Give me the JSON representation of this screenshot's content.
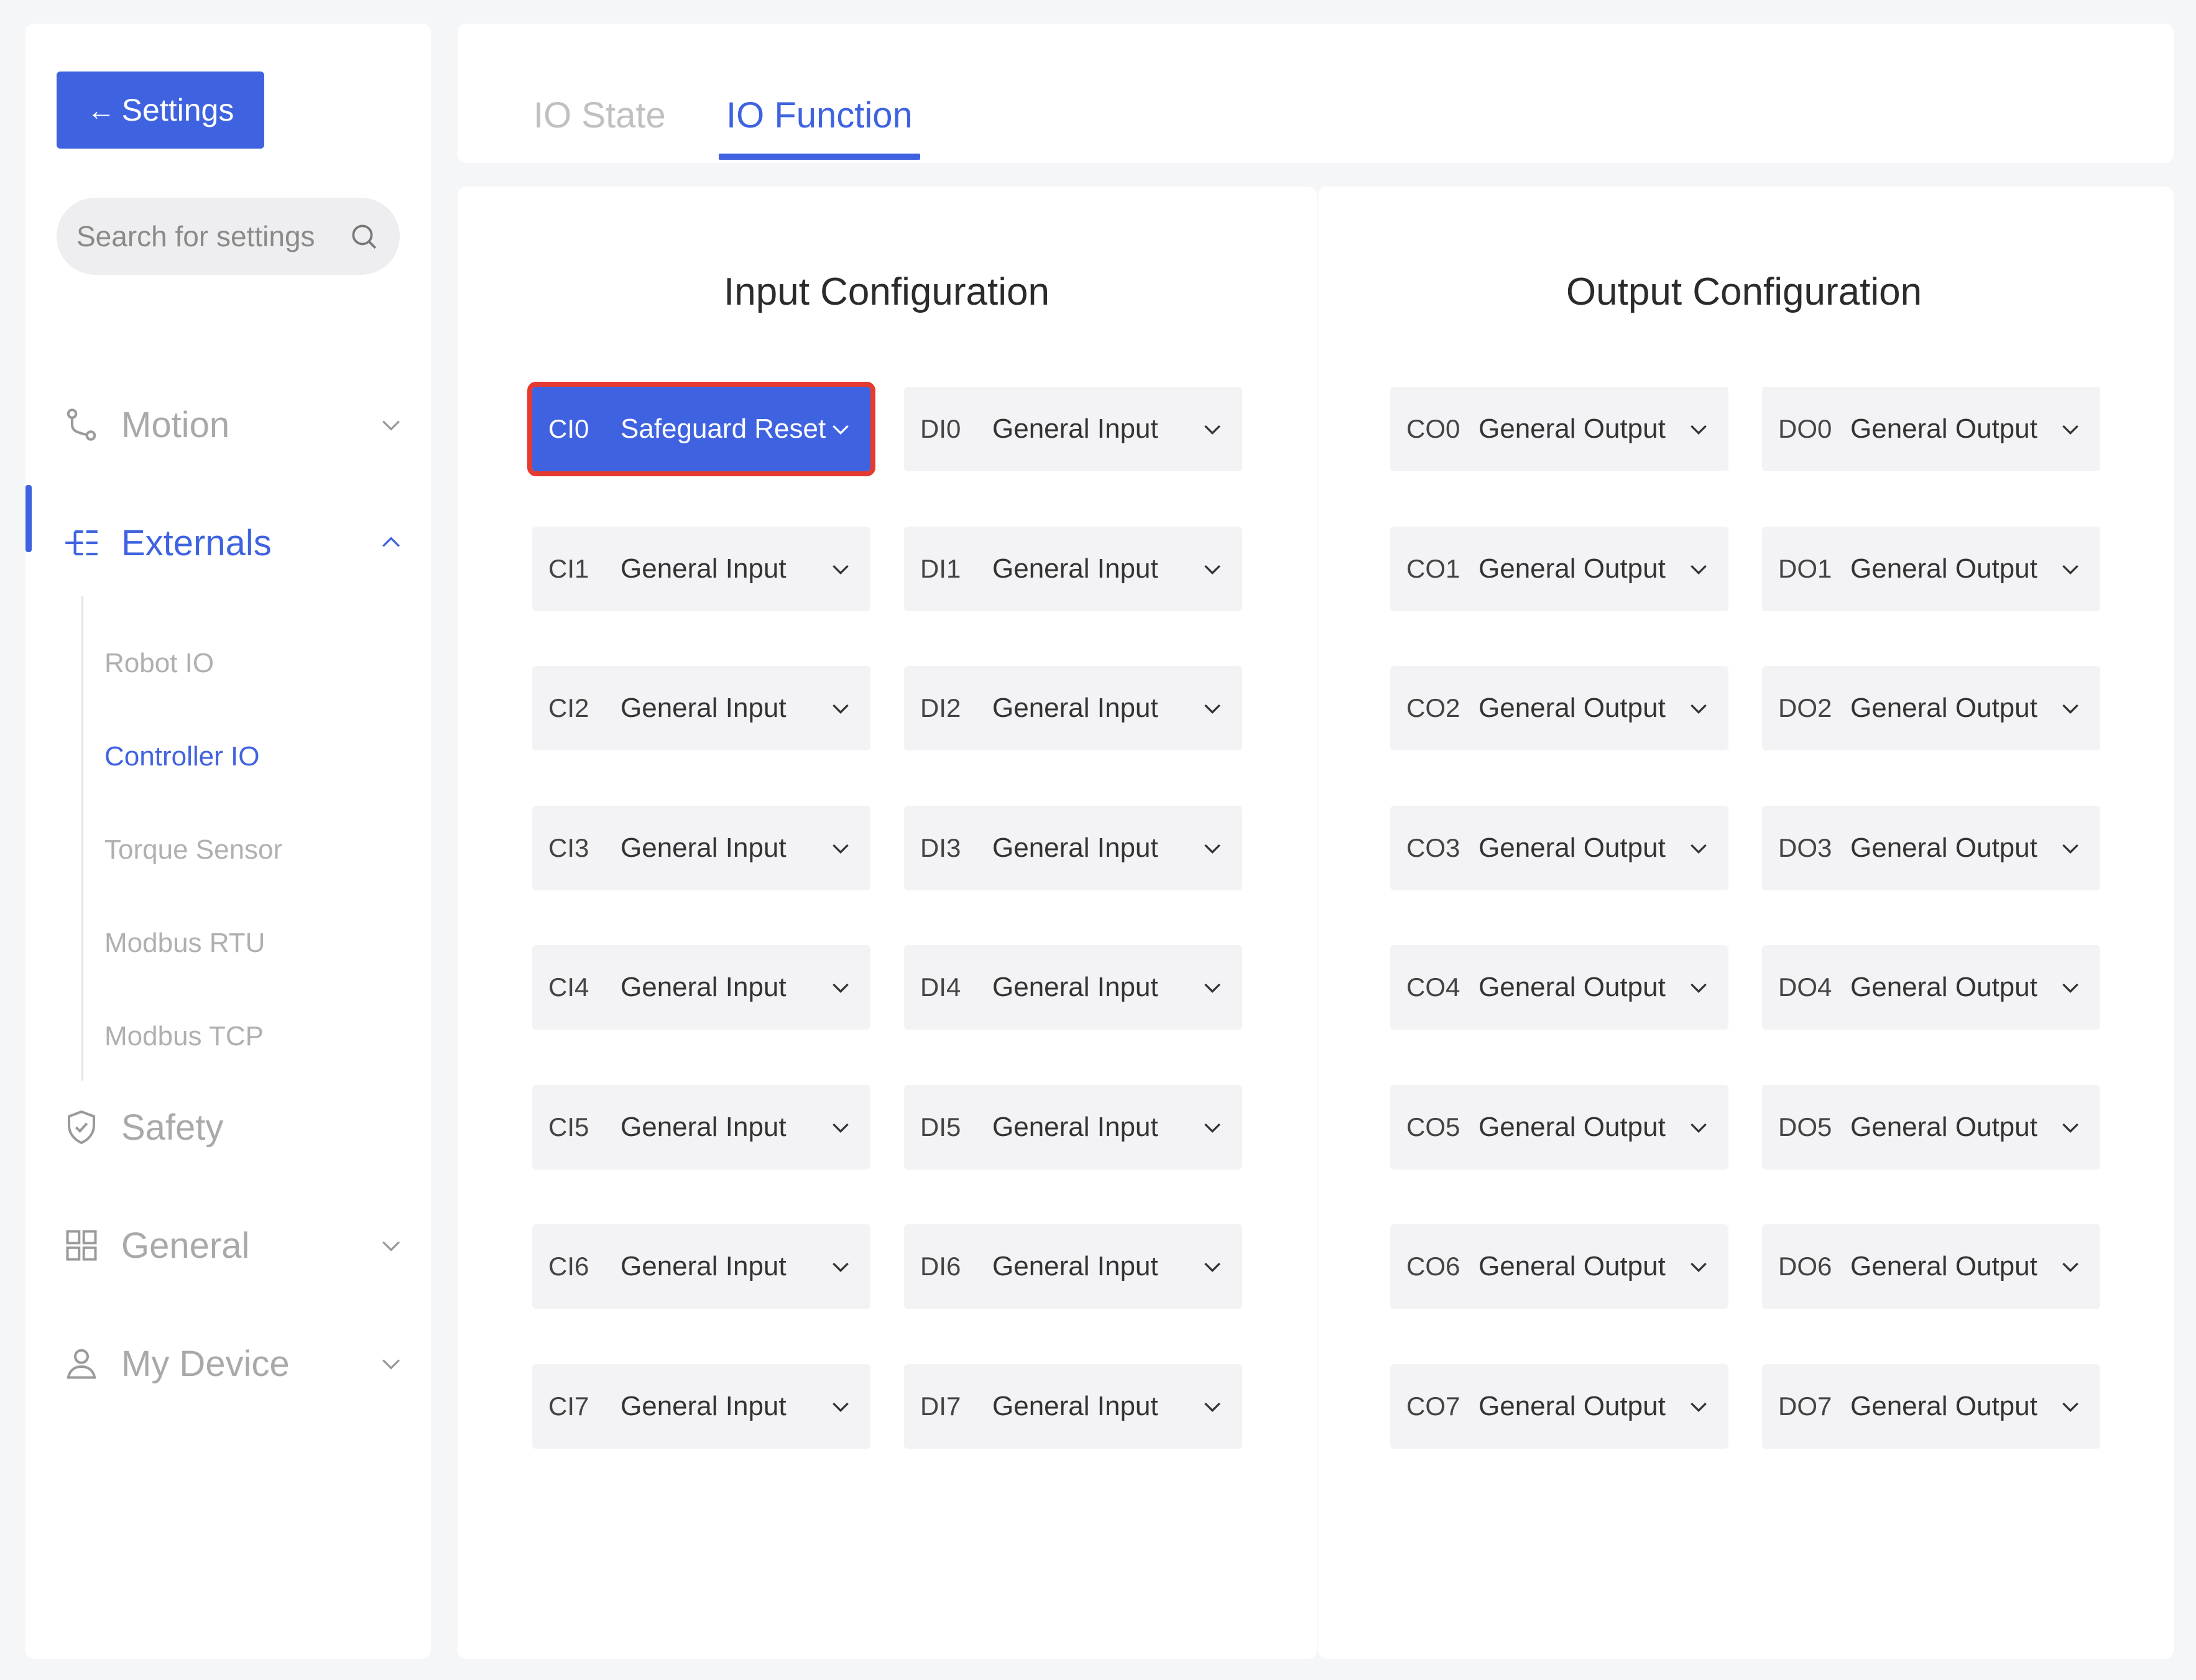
{
  "sidebar": {
    "back_label": "Settings",
    "search_placeholder": "Search for settings",
    "nav": {
      "motion": "Motion",
      "externals": "Externals",
      "safety": "Safety",
      "general": "General",
      "my_device": "My Device"
    },
    "externals_sub": [
      "Robot IO",
      "Controller IO",
      "Torque Sensor",
      "Modbus RTU",
      "Modbus TCP"
    ],
    "active_sub": "Controller IO"
  },
  "tabs": {
    "io_state": "IO State",
    "io_function": "IO Function",
    "active": "IO Function"
  },
  "input_config": {
    "title": "Input Configuration",
    "ci": [
      {
        "code": "CI0",
        "func": "Safeguard Reset"
      },
      {
        "code": "CI1",
        "func": "General Input"
      },
      {
        "code": "CI2",
        "func": "General Input"
      },
      {
        "code": "CI3",
        "func": "General Input"
      },
      {
        "code": "CI4",
        "func": "General Input"
      },
      {
        "code": "CI5",
        "func": "General Input"
      },
      {
        "code": "CI6",
        "func": "General Input"
      },
      {
        "code": "CI7",
        "func": "General Input"
      }
    ],
    "di": [
      {
        "code": "DI0",
        "func": "General Input"
      },
      {
        "code": "DI1",
        "func": "General Input"
      },
      {
        "code": "DI2",
        "func": "General Input"
      },
      {
        "code": "DI3",
        "func": "General Input"
      },
      {
        "code": "DI4",
        "func": "General Input"
      },
      {
        "code": "DI5",
        "func": "General Input"
      },
      {
        "code": "DI6",
        "func": "General Input"
      },
      {
        "code": "DI7",
        "func": "General Input"
      }
    ]
  },
  "output_config": {
    "title": "Output Configuration",
    "co": [
      {
        "code": "CO0",
        "func": "General Output"
      },
      {
        "code": "CO1",
        "func": "General Output"
      },
      {
        "code": "CO2",
        "func": "General Output"
      },
      {
        "code": "CO3",
        "func": "General Output"
      },
      {
        "code": "CO4",
        "func": "General Output"
      },
      {
        "code": "CO5",
        "func": "General Output"
      },
      {
        "code": "CO6",
        "func": "General Output"
      },
      {
        "code": "CO7",
        "func": "General Output"
      }
    ],
    "do": [
      {
        "code": "DO0",
        "func": "General Output"
      },
      {
        "code": "DO1",
        "func": "General Output"
      },
      {
        "code": "DO2",
        "func": "General Output"
      },
      {
        "code": "DO3",
        "func": "General Output"
      },
      {
        "code": "DO4",
        "func": "General Output"
      },
      {
        "code": "DO5",
        "func": "General Output"
      },
      {
        "code": "DO6",
        "func": "General Output"
      },
      {
        "code": "DO7",
        "func": "General Output"
      }
    ]
  },
  "colors": {
    "accent": "#3f63e0",
    "highlight_border": "#e53a2f",
    "muted_text": "#a9a9a9",
    "box_bg": "#f3f3f5"
  },
  "icons": {
    "search": "search-icon",
    "motion": "motion-path-icon",
    "externals": "tree-branch-icon",
    "safety": "shield-check-icon",
    "general": "grid-icon",
    "my_device": "user-icon",
    "dropdown": "chevron-down-icon"
  }
}
